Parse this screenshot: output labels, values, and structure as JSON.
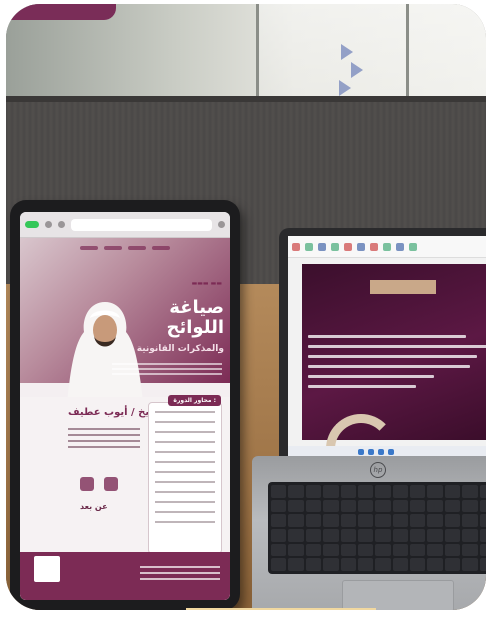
{
  "colors": {
    "brand": "#7c2b55",
    "slide_background": "#4a1238",
    "desk": "#a37a4c"
  },
  "tablet": {
    "heading": "صياغة اللوائح",
    "subheading": "والمذكرات القانونية",
    "presenter": "الشيخ / أيوب عطيف",
    "axes_label": "محاور الدورة :",
    "date_label": "عن بعد"
  },
  "icons": [
    "browser-back-icon",
    "browser-tabs-icon",
    "qr-code-icon",
    "hp-logo-icon",
    "certificate-icon"
  ]
}
